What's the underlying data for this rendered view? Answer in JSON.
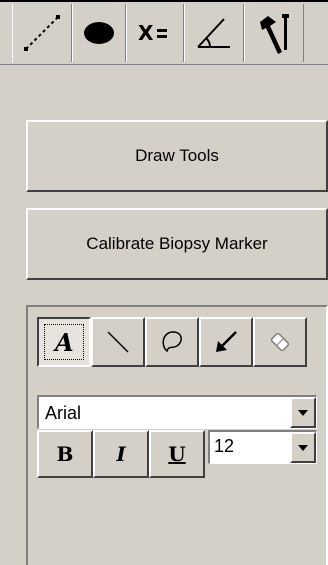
{
  "tabs": [
    {
      "icon": "line-measure-icon"
    },
    {
      "icon": "ellipse-icon"
    },
    {
      "icon": "formula-icon",
      "label": "X="
    },
    {
      "icon": "angle-icon"
    },
    {
      "icon": "tools-icon"
    }
  ],
  "buttons": {
    "draw_tools": "Draw Tools",
    "calibrate": "Calibrate Biopsy Marker"
  },
  "draw_tools": {
    "tools": [
      "text-tool-icon",
      "line-tool-icon",
      "freehand-tool-icon",
      "arrow-tool-icon",
      "eraser-tool-icon"
    ],
    "text_tool_glyph": "A",
    "font": {
      "selected": "Arial"
    },
    "bold_label": "B",
    "italic_label": "I",
    "underline_label": "U",
    "size": {
      "selected": "12"
    }
  }
}
